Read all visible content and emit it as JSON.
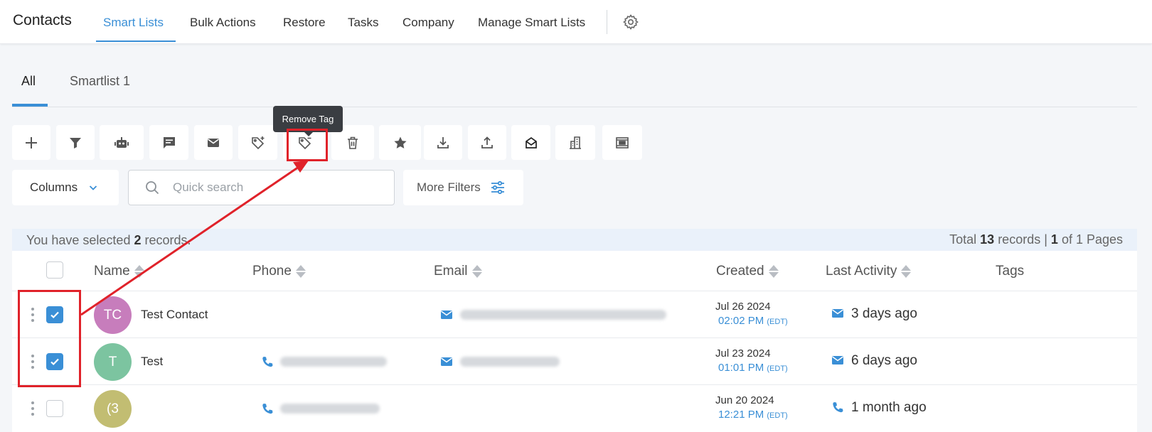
{
  "header": {
    "app_title": "Contacts",
    "nav": [
      "Smart Lists",
      "Bulk Actions",
      "Restore",
      "Tasks",
      "Company",
      "Manage Smart Lists"
    ]
  },
  "subtabs": [
    "All",
    "Smartlist 1"
  ],
  "toolbar": {
    "tooltip": "Remove Tag",
    "buttons": [
      "add-icon",
      "filter-icon",
      "robot-icon",
      "message-icon",
      "email-icon",
      "add-tag-icon",
      "remove-tag-icon",
      "delete-icon",
      "star-icon",
      "download-icon",
      "upload-icon",
      "mailbox-icon",
      "building-icon",
      "merge-icon"
    ]
  },
  "controls": {
    "columns_label": "Columns",
    "search_placeholder": "Quick search",
    "more_filters_label": "More Filters"
  },
  "selection": {
    "prefix": "You have selected",
    "count": "2",
    "suffix": "records.",
    "total_prefix": "Total",
    "total": "13",
    "records_word": "records |",
    "page": "1",
    "pages_suffix": "of 1 Pages"
  },
  "table": {
    "columns": [
      "Name",
      "Phone",
      "Email",
      "Created",
      "Last Activity",
      "Tags"
    ],
    "rows": [
      {
        "initials": "TC",
        "name": "Test Contact",
        "created_date": "Jul 26 2024",
        "created_time": "02:02 PM",
        "tz": "(EDT)",
        "activity": "3 days ago",
        "checked": true,
        "avatar_color": "#c77dbc"
      },
      {
        "initials": "T",
        "name": "Test",
        "created_date": "Jul 23 2024",
        "created_time": "01:01 PM",
        "tz": "(EDT)",
        "activity": "6 days ago",
        "checked": true,
        "avatar_color": "#7cc4a0"
      },
      {
        "initials": "(3",
        "name": "",
        "created_date": "Jun 20 2024",
        "created_time": "12:21 PM",
        "tz": "(EDT)",
        "activity": "1 month ago",
        "checked": false,
        "avatar_color": "#c2bd72"
      }
    ]
  },
  "colors": {
    "accent": "#3a8fd6",
    "annotation": "#e0222a"
  }
}
